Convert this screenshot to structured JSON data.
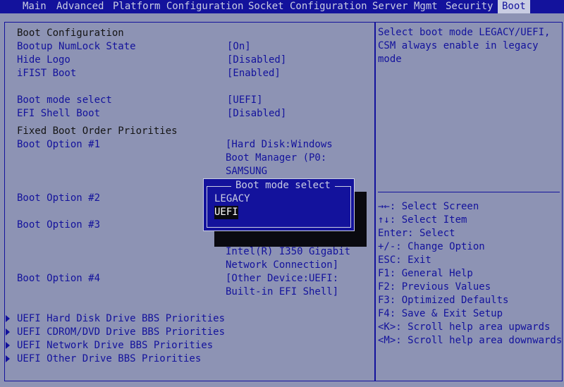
{
  "menu": {
    "tabs": [
      {
        "label": "Main"
      },
      {
        "label": "Advanced"
      },
      {
        "label": "Platform Configuration"
      },
      {
        "label": "Socket Configuration"
      },
      {
        "label": "Server Mgmt"
      },
      {
        "label": "Security"
      },
      {
        "label": "Boot"
      }
    ],
    "active_tab": "Boot"
  },
  "left": {
    "heading": "Boot Configuration",
    "settings": [
      {
        "label": "Bootup NumLock State",
        "value": "[On]"
      },
      {
        "label": "Hide Logo",
        "value": "[Disabled]"
      },
      {
        "label": "iFIST Boot",
        "value": "[Enabled]"
      },
      {
        "label": "Boot mode select",
        "value": "[UEFI]"
      },
      {
        "label": "EFI Shell Boot",
        "value": "[Disabled]"
      }
    ],
    "fixed_heading": "Fixed Boot Order Priorities",
    "boot_options": [
      {
        "label": "Boot Option #1",
        "value_lines": [
          "[Hard Disk:Windows",
          "Boot Manager (P0:",
          "SAMSUNG"
        ]
      },
      {
        "label": "Boot Option #2",
        "value_lines": []
      },
      {
        "label": "Boot Option #3",
        "value_lines": [
          "Intel(R) I350 Gigabit",
          "Network Connection]"
        ]
      },
      {
        "label": "Boot Option #4",
        "value_lines": [
          "[Other Device:UEFI:",
          "Built-in EFI Shell]"
        ]
      }
    ],
    "submenus": [
      {
        "label": "UEFI Hard Disk Drive BBS Priorities"
      },
      {
        "label": "UEFI CDROM/DVD Drive BBS Priorities"
      },
      {
        "label": "UEFI Network Drive BBS Priorities"
      },
      {
        "label": "UEFI Other Drive BBS Priorities"
      }
    ]
  },
  "help": {
    "lines": [
      "Select boot mode LEGACY/UEFI,",
      "CSM always enable in legacy",
      "mode"
    ]
  },
  "keys": {
    "lines": [
      "→←: Select Screen",
      "↑↓: Select Item",
      "Enter: Select",
      "+/-: Change Option",
      "ESC: Exit",
      "F1: General Help",
      "F2: Previous Values",
      "F3: Optimized Defaults",
      "F4: Save & Exit Setup",
      "<K>: Scroll help area upwards",
      "<M>: Scroll help area downwards"
    ]
  },
  "popup": {
    "title": "Boot mode select",
    "options": [
      {
        "label": "LEGACY"
      },
      {
        "label": "UEFI"
      }
    ],
    "selected": "UEFI"
  },
  "colors": {
    "background": "#8d93b4",
    "menubar": "#13129c",
    "text_black": "#141414",
    "text_blue": "#13129c",
    "highlight": "#c9cde3"
  }
}
